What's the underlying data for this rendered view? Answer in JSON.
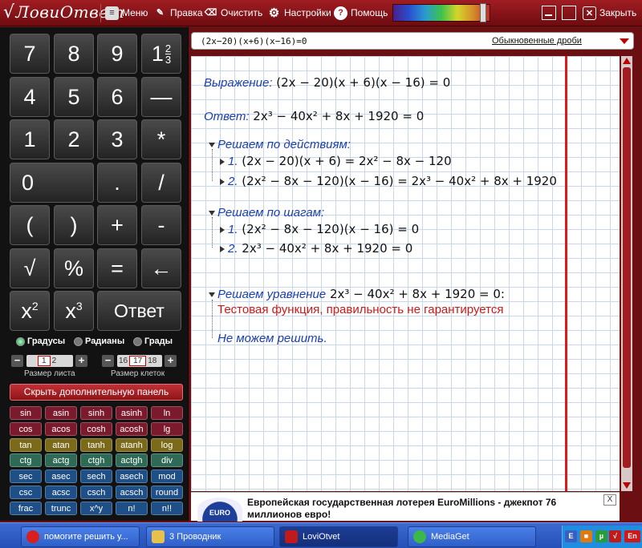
{
  "app": {
    "logo": "ЛовиОтвет",
    "logo_root": "√"
  },
  "toolbar": {
    "menu": "Меню",
    "edit": "Правка",
    "clear": "Очистить",
    "settings": "Настройки",
    "help": "Помощь",
    "close": "Закрыть"
  },
  "keypad": {
    "rows": [
      [
        "7",
        "8",
        "9",
        "1 2/3"
      ],
      [
        "4",
        "5",
        "6",
        "—"
      ],
      [
        "1",
        "2",
        "3",
        "*"
      ],
      [
        "0",
        ".",
        "/"
      ],
      [
        "(",
        ")",
        "+",
        "-"
      ],
      [
        "√",
        "%",
        "=",
        "←"
      ],
      [
        "x2",
        "x3",
        "Ответ"
      ]
    ],
    "mixed_whole": "1",
    "mixed_num": "2",
    "mixed_den": "3",
    "x2_base": "x",
    "x2_exp": "2",
    "x3_base": "x",
    "x3_exp": "3"
  },
  "angle_units": {
    "degrees": "Градусы",
    "radians": "Радианы",
    "grads": "Грады",
    "selected": "degrees"
  },
  "sheet_size": {
    "label": "Размер листа",
    "values": [
      "1",
      "2"
    ],
    "current": "1"
  },
  "cell_size": {
    "label": "Размер клеток",
    "values": [
      "16",
      "17",
      "18"
    ],
    "current": "17"
  },
  "extra_panel_button": "Скрыть дополнительную панель",
  "functions": [
    [
      "sin",
      "asin",
      "sinh",
      "asinh",
      "ln"
    ],
    [
      "cos",
      "acos",
      "cosh",
      "acosh",
      "lg"
    ],
    [
      "tan",
      "atan",
      "tanh",
      "atanh",
      "log"
    ],
    [
      "ctg",
      "actg",
      "ctgh",
      "actgh",
      "div"
    ],
    [
      "sec",
      "asec",
      "sech",
      "asech",
      "mod"
    ],
    [
      "csc",
      "acsc",
      "csch",
      "acsch",
      "round"
    ],
    [
      "frac",
      "trunc",
      "x^y",
      "n!",
      "n!!"
    ]
  ],
  "function_colors": [
    "#7a1a2c",
    "#7a1a2c",
    "#7a6a1a",
    "#2e6a55",
    "#1e4f86",
    "#1e4f86",
    "#1e4f86"
  ],
  "input": {
    "expression": "(2x−20)(x+6)(x−16)=0",
    "mode": "Обыкновенные дроби"
  },
  "solution": {
    "expr_label": "Выражение:",
    "expr": "(2x − 20)(x + 6)(x − 16) = 0",
    "answer_label": "Ответ:",
    "answer": "2x³ − 40x² + 8x + 1920 = 0",
    "by_actions_title": "Решаем по действиям:",
    "by_actions": [
      {
        "n": "1.",
        "text": "(2x − 20)(x + 6) = 2x² − 8x − 120"
      },
      {
        "n": "2.",
        "text": "(2x² − 8x − 120)(x − 16) = 2x³ − 40x² + 8x + 1920"
      }
    ],
    "by_steps_title": "Решаем по шагам:",
    "by_steps": [
      {
        "n": "1.",
        "text": "(2x² − 8x − 120)(x − 16) = 0"
      },
      {
        "n": "2.",
        "text": "2x³ − 40x² + 8x + 1920 = 0"
      }
    ],
    "equation_title": "Решаем уравнение",
    "equation_expr": "2x³ − 40x² + 8x + 1920 = 0:",
    "warning": "Тестовая функция, правильность не гарантируется",
    "cannot_solve": "Не можем решить."
  },
  "ad": {
    "logo_text": "EURO",
    "text": "Европейская государственная лотерея EuroMillions - джекпот 76 миллионов евро!",
    "close": "X"
  },
  "taskbar": {
    "items": [
      {
        "label": "помогите решить у...",
        "active": false
      },
      {
        "label": "3 Проводник",
        "active": false
      },
      {
        "label": "LoviOtvet",
        "active": true
      },
      {
        "label": "MediaGet",
        "active": false
      }
    ],
    "lang": "En"
  }
}
